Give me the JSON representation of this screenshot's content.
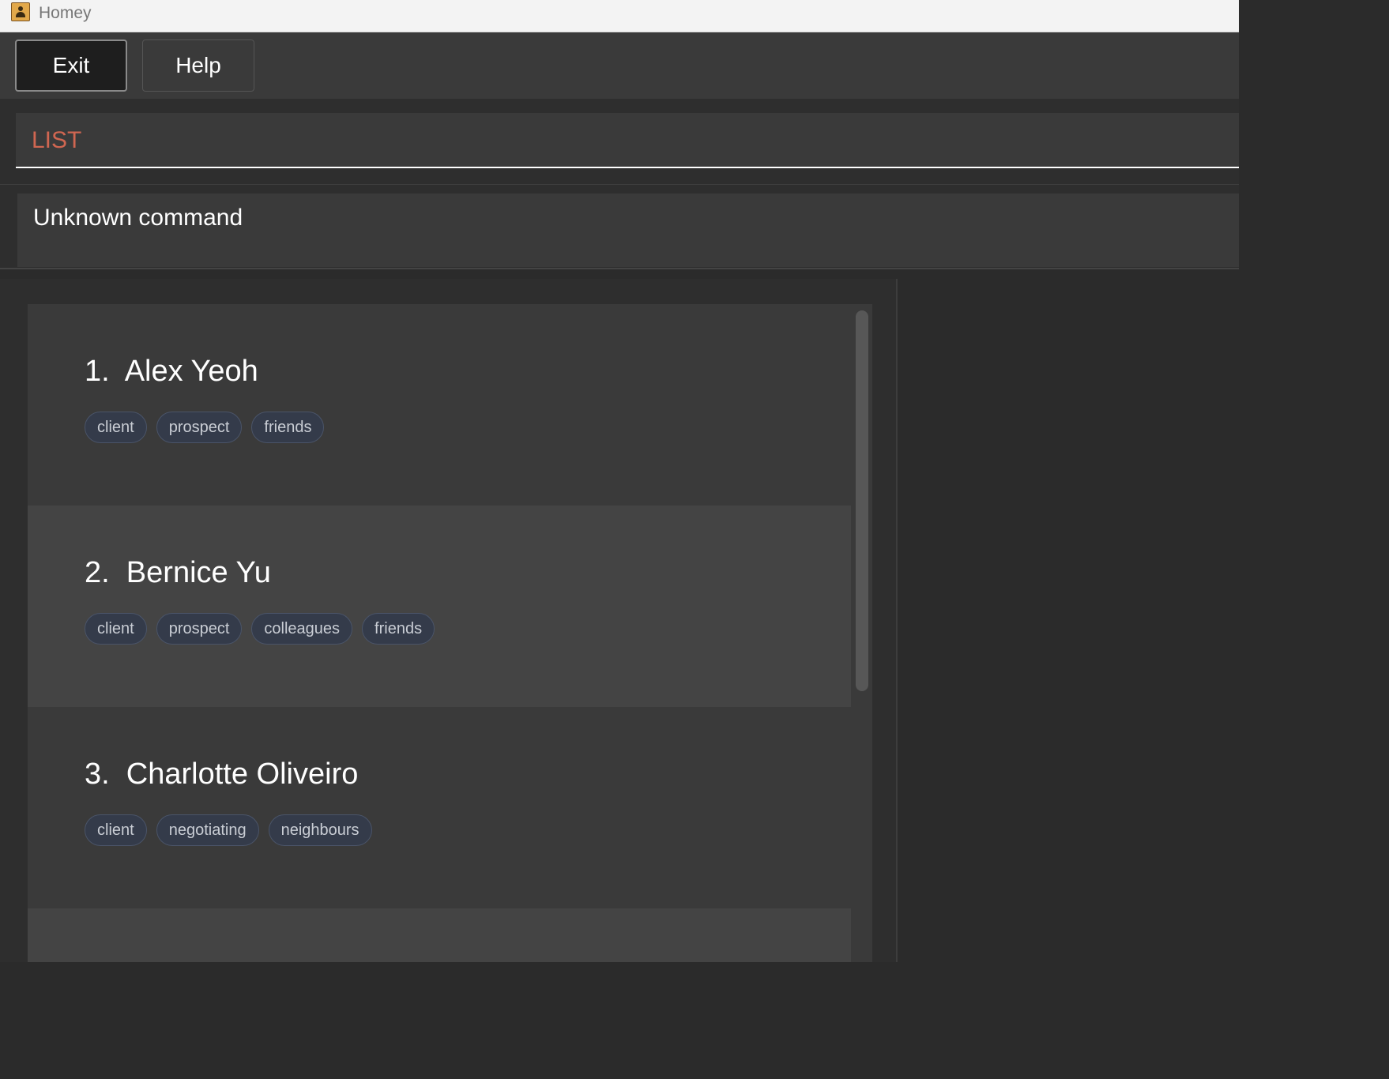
{
  "window": {
    "title": "Homey"
  },
  "menu": {
    "exit_label": "Exit",
    "help_label": "Help"
  },
  "command": {
    "value": "LIST"
  },
  "result": {
    "text": "Unknown command"
  },
  "persons": [
    {
      "index_name": "1.  Alex Yeoh",
      "tags": [
        "client",
        "prospect",
        "friends"
      ]
    },
    {
      "index_name": "2.  Bernice Yu",
      "tags": [
        "client",
        "prospect",
        "colleagues",
        "friends"
      ]
    },
    {
      "index_name": "3.  Charlotte Oliveiro",
      "tags": [
        "client",
        "negotiating",
        "neighbours"
      ]
    }
  ],
  "colors": {
    "command_text": "#d06651",
    "tag_bg": "#343b4a"
  },
  "icons": {
    "app_icon": "address-book-icon"
  }
}
